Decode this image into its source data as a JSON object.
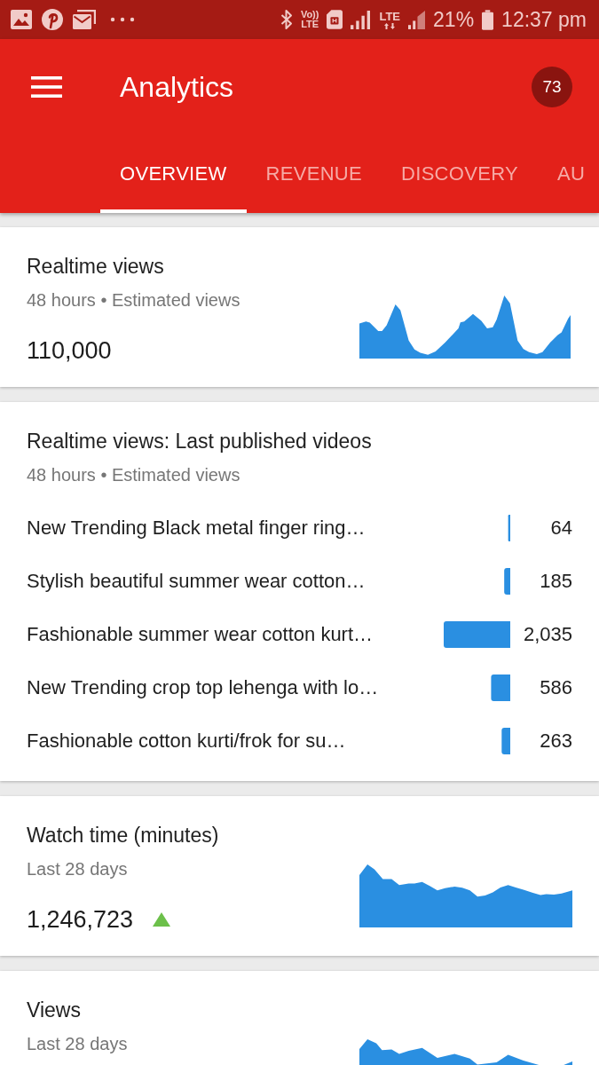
{
  "status_bar": {
    "volte": [
      "Vo))",
      "LTE"
    ],
    "network": "LTE",
    "battery": "21%",
    "time": "12:37 pm"
  },
  "app_bar": {
    "title": "Analytics",
    "badge": "73"
  },
  "tabs": [
    {
      "label": "OVERVIEW",
      "selected": true
    },
    {
      "label": "REVENUE",
      "selected": false
    },
    {
      "label": "DISCOVERY",
      "selected": false
    },
    {
      "label": "AU",
      "selected": false
    }
  ],
  "cards": [
    {
      "kind": "metric",
      "title": "Realtime views",
      "subtitle": "48 hours • Estimated views",
      "value": "110,000"
    },
    {
      "kind": "video_list",
      "title": "Realtime views: Last published videos",
      "subtitle": "48 hours • Estimated views",
      "chart_data": {
        "type": "bar",
        "orientation": "horizontal",
        "categories": [
          "New Trending Black metal finger ring…",
          "Stylish beautiful summer wear cotton…",
          "Fashionable summer wear cotton kurt…",
          "New Trending crop top lehenga with lo…",
          "Fashionable cotton kurti/frok for su…"
        ],
        "values": [
          64,
          185,
          2035,
          586,
          263
        ],
        "value_labels": [
          "64",
          "185",
          "2,035",
          "586",
          "263"
        ]
      }
    },
    {
      "kind": "metric",
      "title": "Watch time (minutes)",
      "subtitle": "Last 28 days",
      "value": "1,246,723",
      "trend_up": true
    },
    {
      "kind": "metric",
      "title": "Views",
      "subtitle": "Last 28 days"
    }
  ]
}
